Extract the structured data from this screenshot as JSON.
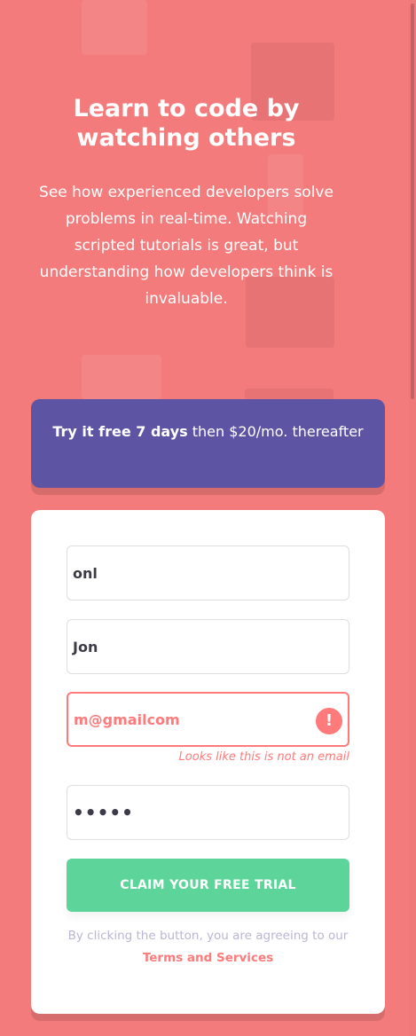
{
  "hero": {
    "title": "Learn to code by watching others",
    "description": "See how experienced developers solve problems in real-time. Watching scripted tutorials is great, but understanding how developers think is invaluable."
  },
  "promo": {
    "highlight": "Try it free 7 days",
    "rest": "then $20/mo. thereafter"
  },
  "form": {
    "first_name": "onl",
    "last_name": "Jon",
    "email": "m@gmailcom",
    "email_error": "Looks like this is not an email",
    "password_display": "•••••",
    "error_icon_glyph": "!",
    "submit_label": "CLAIM YOUR FREE TRIAL",
    "terms_prefix": "By clicking the button, you are agreeing to our",
    "terms_link": "Terms and Services"
  },
  "colors": {
    "background": "#f47b7c",
    "promo_bg": "#5e54a4",
    "cta_bg": "#5dd59a",
    "error": "#ff7a7a",
    "terms_text": "#b9b6d3"
  },
  "icons": [
    "error-icon"
  ]
}
